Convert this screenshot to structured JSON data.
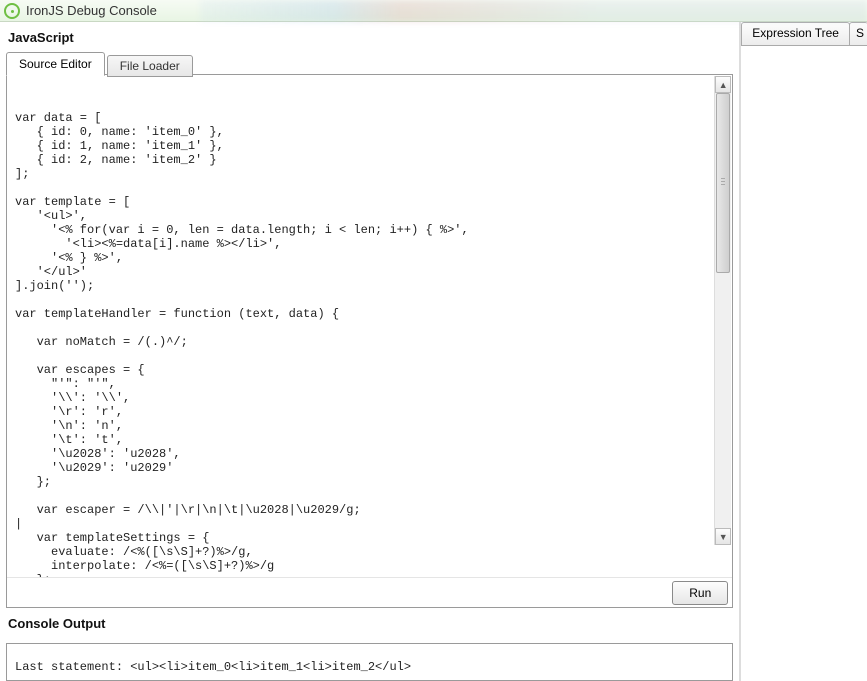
{
  "window": {
    "title": "IronJS Debug Console"
  },
  "left": {
    "heading": "JavaScript",
    "tabs": {
      "source": "Source Editor",
      "loader": "File Loader"
    },
    "run_label": "Run",
    "code_lines": [
      "",
      "var data = [",
      "   { id: 0, name: 'item_0' },",
      "   { id: 1, name: 'item_1' },",
      "   { id: 2, name: 'item_2' }",
      "];",
      "",
      "var template = [",
      "   '<ul>',",
      "     '<% for(var i = 0, len = data.length; i < len; i++) { %>',",
      "       '<li><%=data[i].name %></li>',",
      "     '<% } %>',",
      "   '</ul>'",
      "].join('');",
      "",
      "var templateHandler = function (text, data) {",
      "",
      "   var noMatch = /(.)^/;",
      "",
      "   var escapes = {",
      "     \"'\": \"'\",",
      "     '\\\\': '\\\\',",
      "     '\\r': 'r',",
      "     '\\n': 'n',",
      "     '\\t': 't',",
      "     '\\u2028': 'u2028',",
      "     '\\u2029': 'u2029'",
      "   };",
      "",
      "   var escaper = /\\\\|'|\\r|\\n|\\t|\\u2028|\\u2029/g;",
      "|",
      "   var templateSettings = {",
      "     evaluate: /<%([\\s\\S]+?)%>/g,",
      "     interpolate: /<%=([\\s\\S]+?)%>/g",
      "   };"
    ],
    "console_title": "Console Output",
    "console_text": "Last statement: <ul><li>item_0<li>item_1<li>item_2</ul>"
  },
  "right": {
    "tab1": "Expression Tree",
    "tab2_cut": "S"
  }
}
